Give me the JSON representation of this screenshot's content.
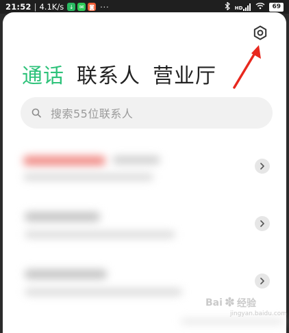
{
  "status_bar": {
    "time": "21:52",
    "net_speed": "4.1K/s",
    "more": "···",
    "network_label": "HD",
    "battery": "69"
  },
  "tabs": [
    {
      "label": "通话",
      "active": true
    },
    {
      "label": "联系人",
      "active": false
    },
    {
      "label": "营业厅",
      "active": false
    }
  ],
  "search": {
    "placeholder": "搜索55位联系人"
  },
  "colors": {
    "accent": "#2ec27a",
    "annotation_arrow": "#e8281e"
  },
  "watermark": {
    "brand": "Bai",
    "brand2": "经验",
    "sub": "jingyan.baidu.com"
  }
}
